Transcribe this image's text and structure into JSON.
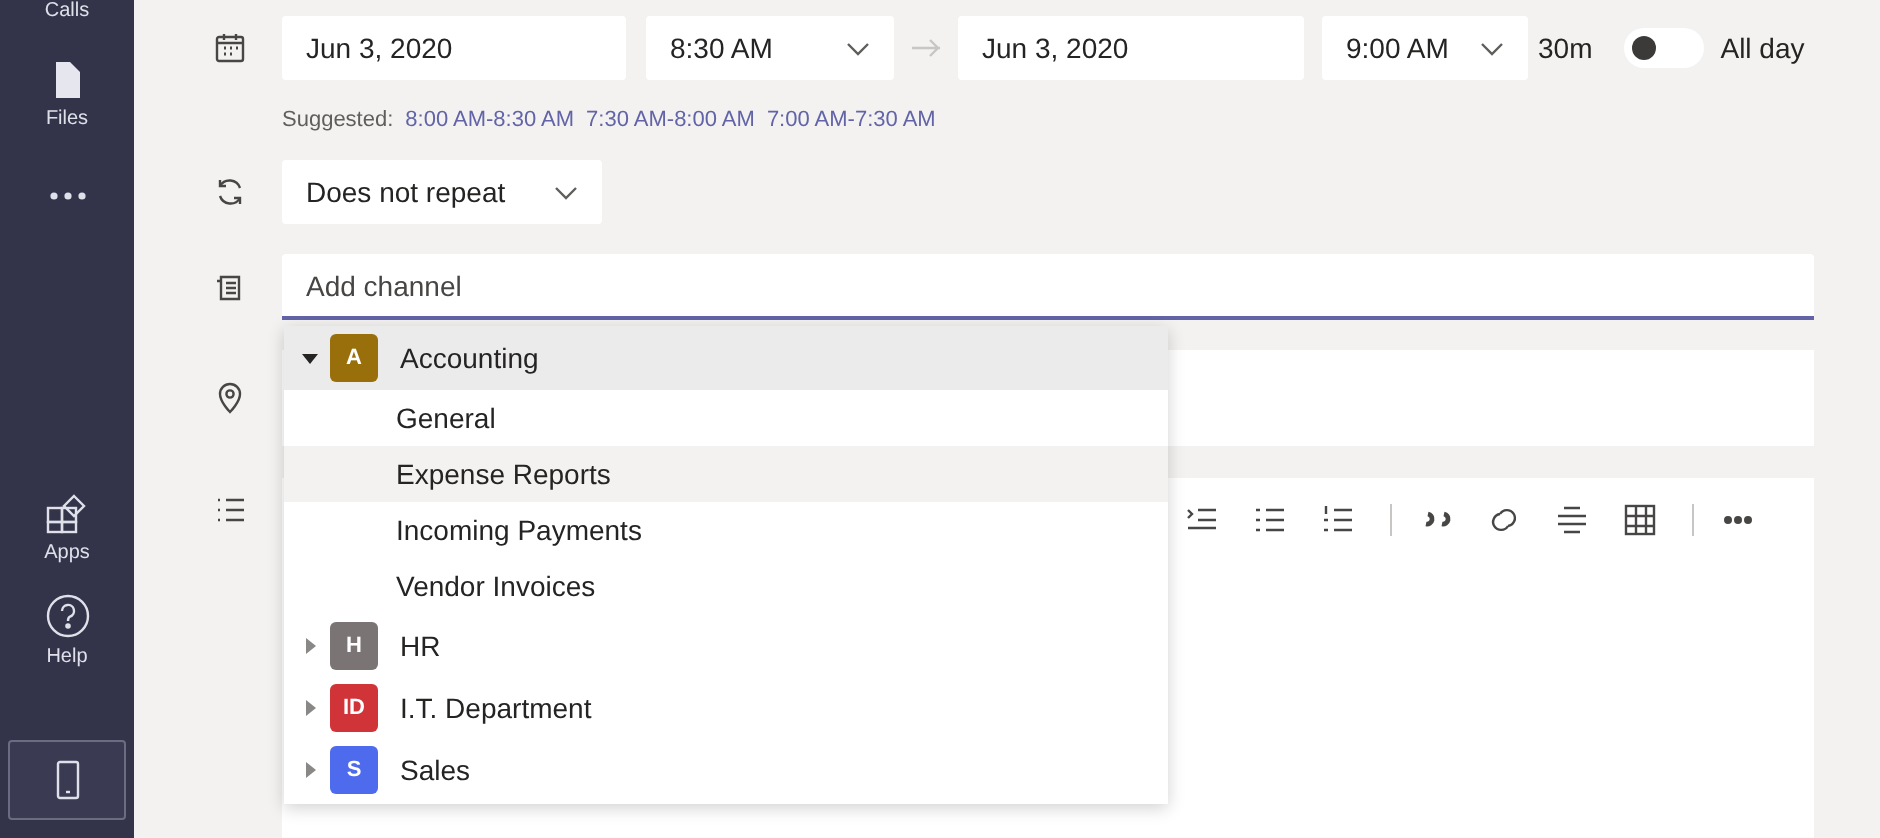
{
  "rail": {
    "items": [
      {
        "kind": "calls",
        "label": "Calls"
      },
      {
        "kind": "files",
        "label": "Files"
      },
      {
        "kind": "more"
      },
      {
        "kind": "apps",
        "label": "Apps"
      },
      {
        "kind": "help",
        "label": "Help"
      },
      {
        "kind": "device"
      }
    ]
  },
  "schedule": {
    "start_date": "Jun 3, 2020",
    "start_time": "8:30 AM",
    "end_date": "Jun 3, 2020",
    "end_time": "9:00 AM",
    "duration": "30m",
    "all_day": {
      "label": "All day",
      "on": false
    }
  },
  "suggested": {
    "label": "Suggested:",
    "times": [
      "8:00 AM-8:30 AM",
      "7:30 AM-8:00 AM",
      "7:00 AM-7:30 AM"
    ]
  },
  "repeat": {
    "value": "Does not repeat"
  },
  "channel": {
    "placeholder": "Add channel"
  },
  "channel_dropdown": {
    "teams": [
      {
        "initial": "A",
        "name": "Accounting",
        "color": "#986f0b",
        "expanded": true,
        "channels": [
          {
            "name": "General",
            "selected": false
          },
          {
            "name": "Expense Reports",
            "selected": true
          },
          {
            "name": "Incoming Payments",
            "selected": false
          },
          {
            "name": "Vendor Invoices",
            "selected": false
          }
        ]
      },
      {
        "initial": "H",
        "name": "HR",
        "color": "#7a7574",
        "expanded": false
      },
      {
        "initial": "ID",
        "name": "I.T. Department",
        "color": "#d13438",
        "expanded": false
      },
      {
        "initial": "S",
        "name": "Sales",
        "color": "#4f6bed",
        "expanded": false
      }
    ]
  }
}
